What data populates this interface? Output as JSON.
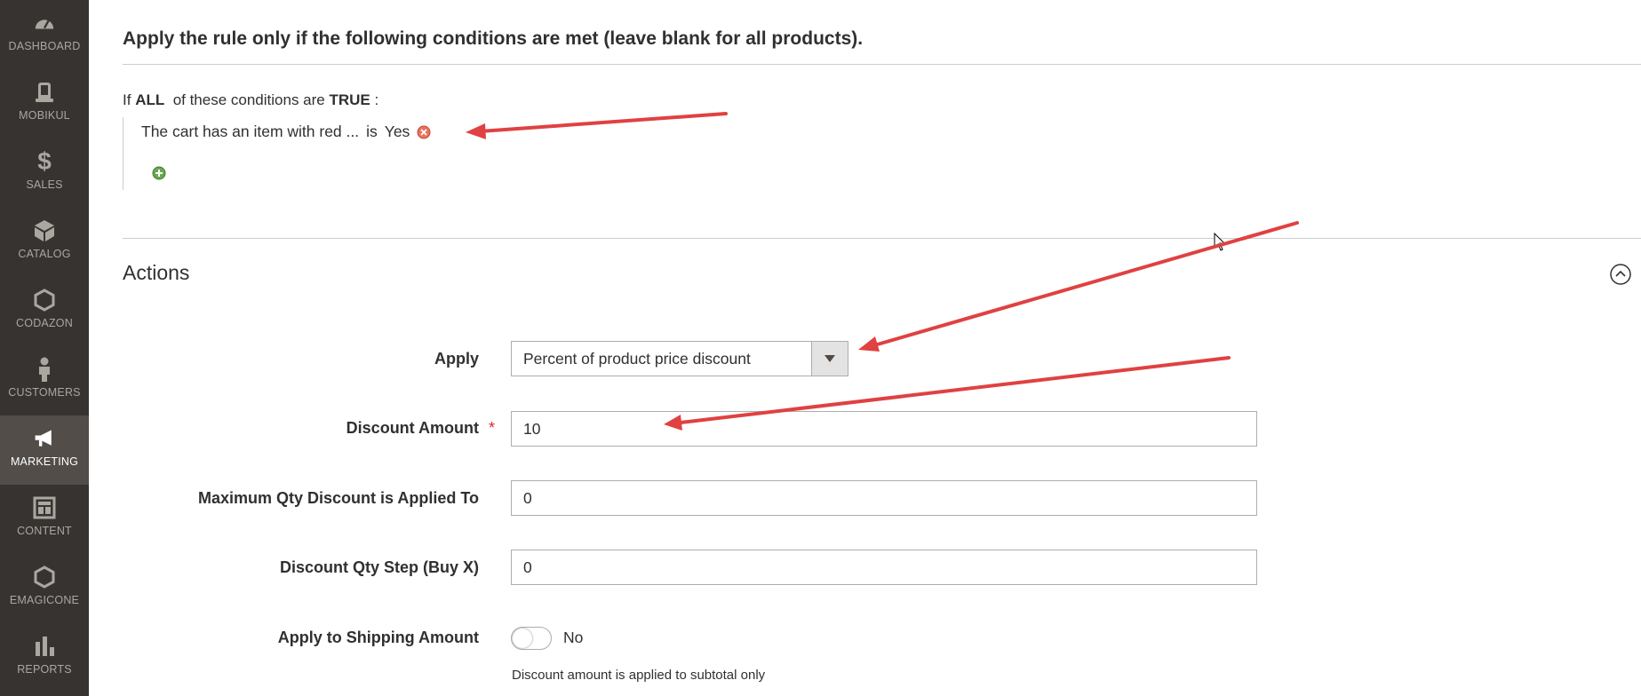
{
  "sidebar": {
    "items": [
      {
        "label": "DASHBOARD",
        "icon": "dashboard-icon",
        "active": false
      },
      {
        "label": "MOBIKUL",
        "icon": "mobikul-icon",
        "active": false
      },
      {
        "label": "SALES",
        "icon": "dollar-icon",
        "active": false
      },
      {
        "label": "CATALOG",
        "icon": "catalog-box-icon",
        "active": false
      },
      {
        "label": "CODAZON",
        "icon": "hexagon-icon",
        "active": false
      },
      {
        "label": "CUSTOMERS",
        "icon": "person-icon",
        "active": false
      },
      {
        "label": "MARKETING",
        "icon": "megaphone-icon",
        "active": true
      },
      {
        "label": "CONTENT",
        "icon": "content-layout-icon",
        "active": false
      },
      {
        "label": "EMAGICONE",
        "icon": "hexagon-icon",
        "active": false
      },
      {
        "label": "REPORTS",
        "icon": "bar-chart-icon",
        "active": false
      }
    ]
  },
  "conditions": {
    "title": "Apply the rule only if the following conditions are met (leave blank for all products).",
    "if_text": "If",
    "aggregator": "ALL",
    "middle_text": "of these conditions are",
    "value": "TRUE",
    "colon": ":",
    "rule": {
      "attribute": "The cart has an item with red ...",
      "operator": "is",
      "value": "Yes"
    }
  },
  "actions": {
    "title": "Actions",
    "apply_label": "Apply",
    "apply_value": "Percent of product price discount",
    "discount_amount_label": "Discount Amount",
    "discount_amount_required": "*",
    "discount_amount_value": "10",
    "max_qty_label": "Maximum Qty Discount is Applied To",
    "max_qty_value": "0",
    "qty_step_label": "Discount Qty Step (Buy X)",
    "qty_step_value": "0",
    "shipping_label": "Apply to Shipping Amount",
    "shipping_toggle_text": "No",
    "shipping_note": "Discount amount is applied to subtotal only"
  },
  "colors": {
    "sidebar_bg": "#373330",
    "sidebar_active_bg": "#524d49",
    "annotation_arrow": "#e04141",
    "required": "#e22626"
  }
}
